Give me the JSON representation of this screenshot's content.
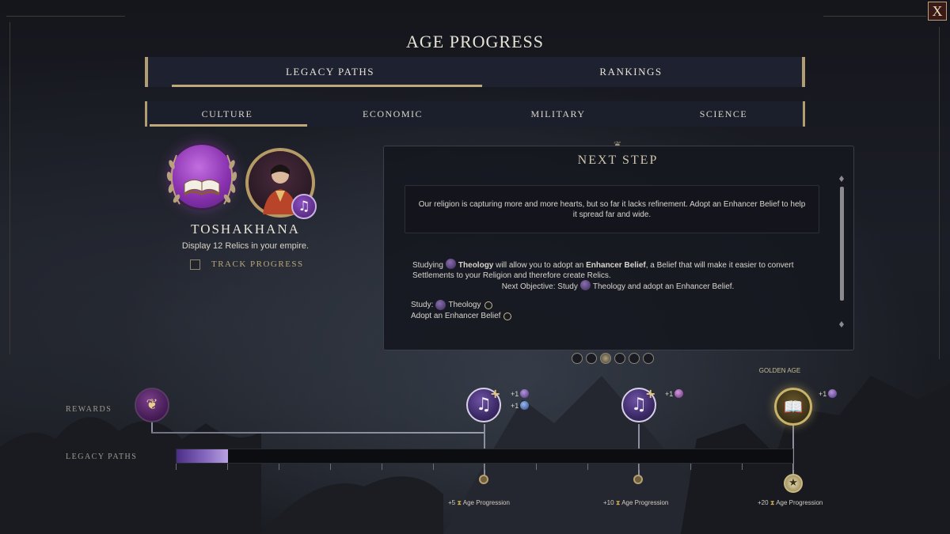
{
  "window": {
    "title": "AGE PROGRESS",
    "close_label": "X"
  },
  "tabs": [
    {
      "label": "LEGACY PATHS",
      "active": true
    },
    {
      "label": "RANKINGS",
      "active": false
    }
  ],
  "subtabs": [
    {
      "label": "CULTURE",
      "active": true
    },
    {
      "label": "ECONOMIC",
      "active": false
    },
    {
      "label": "MILITARY",
      "active": false
    },
    {
      "label": "SCIENCE",
      "active": false
    }
  ],
  "wonder": {
    "name": "TOSHAKHANA",
    "description": "Display 12 Relics in your empire.",
    "track_label": "TRACK PROGRESS",
    "track_checked": false,
    "icon": "open-book-icon",
    "portrait_badge_icon": "music-note-icon"
  },
  "next_step": {
    "title": "NEXT STEP",
    "quote": "Our religion is capturing more and more hearts, but so far it lacks refinement. Adopt an Enhancer Belief to help it spread far and wide.",
    "body_parts": {
      "pre": "Studying",
      "theology": "Theology",
      "mid": "will allow you to adopt an",
      "enhancer": "Enhancer Belief",
      "post": ", a Belief that will make it easier to convert Settlements to your Religion and therefore create Relics."
    },
    "next_objective_prefix": "Next Objective: Study",
    "next_objective_suffix": "Theology and adopt an Enhancer Belief.",
    "objectives": [
      {
        "prefix": "Study:",
        "label": "Theology",
        "done": false
      },
      {
        "prefix": "",
        "label": "Adopt an Enhancer Belief",
        "done": false
      }
    ]
  },
  "pager": {
    "count": 6,
    "active_index": 2
  },
  "track": {
    "rewards_label": "REWARDS",
    "legacy_label": "LEGACY PATHS",
    "golden_age_label": "GOLDEN AGE",
    "progress_fraction": 0.083,
    "rewards": [
      {
        "icon": "harvest-icon",
        "counts": []
      },
      {
        "icon": "music-head-icon",
        "counts": [
          "+1",
          "+1"
        ]
      },
      {
        "icon": "music-head-icon",
        "counts": [
          "+1"
        ]
      },
      {
        "icon": "open-book-icon",
        "counts": [
          "+1"
        ]
      }
    ],
    "milestones": [
      {
        "amount": "+5",
        "label": "Age Progression"
      },
      {
        "amount": "+10",
        "label": "Age Progression"
      },
      {
        "amount": "+20",
        "label": "Age Progression"
      }
    ]
  },
  "colors": {
    "accent_gold": "#c0a87a",
    "culture_purple": "#8a32b0",
    "progress_fill": "#8a6cc2"
  }
}
